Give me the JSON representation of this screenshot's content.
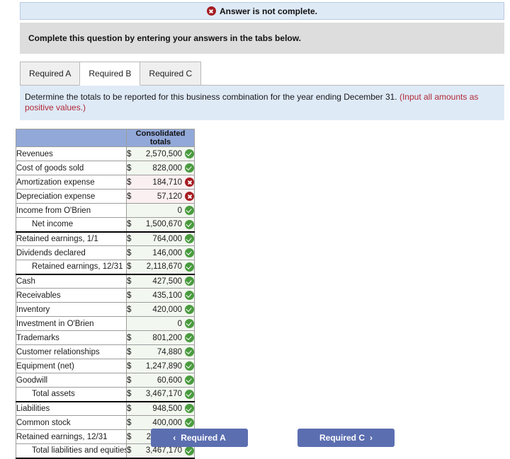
{
  "alert": {
    "icon": "error-x-circle-icon",
    "text": "Answer is not complete."
  },
  "instruction": {
    "text": "Complete this question by entering your answers in the tabs below."
  },
  "tabs": [
    {
      "label": "Required A",
      "active": false
    },
    {
      "label": "Required B",
      "active": true
    },
    {
      "label": "Required C",
      "active": false
    }
  ],
  "prompt": {
    "main": "Determine the totals to be reported for this business combination for the year ending December 31. ",
    "hint": "(Input all amounts as positive values.)"
  },
  "table": {
    "header_blank": "",
    "header_amount": "Consolidated totals",
    "rows": [
      {
        "label": "Revenues",
        "indent": false,
        "currency": "$",
        "amount": "2,570,500",
        "status": "correct",
        "rule": "none"
      },
      {
        "label": "Cost of goods sold",
        "indent": false,
        "currency": "$",
        "amount": "828,000",
        "status": "correct",
        "rule": "none"
      },
      {
        "label": "Amortization expense",
        "indent": false,
        "currency": "$",
        "amount": "184,710",
        "status": "incorrect",
        "rule": "none"
      },
      {
        "label": "Depreciation expense",
        "indent": false,
        "currency": "$",
        "amount": "57,120",
        "status": "incorrect",
        "rule": "none"
      },
      {
        "label": "Income from O'Brien",
        "indent": false,
        "currency": "",
        "amount": "0",
        "status": "correct",
        "rule": "none"
      },
      {
        "label": "Net income",
        "indent": true,
        "currency": "$",
        "amount": "1,500,670",
        "status": "correct",
        "rule": "below"
      },
      {
        "label": "Retained earnings, 1/1",
        "indent": false,
        "currency": "$",
        "amount": "764,000",
        "status": "correct",
        "rule": "none"
      },
      {
        "label": "Dividends declared",
        "indent": false,
        "currency": "$",
        "amount": "146,000",
        "status": "correct",
        "rule": "none"
      },
      {
        "label": "Retained earnings, 12/31",
        "indent": true,
        "currency": "$",
        "amount": "2,118,670",
        "status": "correct",
        "rule": "below"
      },
      {
        "label": "Cash",
        "indent": false,
        "currency": "$",
        "amount": "427,500",
        "status": "correct",
        "rule": "none"
      },
      {
        "label": "Receivables",
        "indent": false,
        "currency": "$",
        "amount": "435,100",
        "status": "correct",
        "rule": "none"
      },
      {
        "label": "Inventory",
        "indent": false,
        "currency": "$",
        "amount": "420,000",
        "status": "correct",
        "rule": "none"
      },
      {
        "label": "Investment in O'Brien",
        "indent": false,
        "currency": "",
        "amount": "0",
        "status": "correct",
        "rule": "none"
      },
      {
        "label": "Trademarks",
        "indent": false,
        "currency": "$",
        "amount": "801,200",
        "status": "correct",
        "rule": "none"
      },
      {
        "label": "Customer relationships",
        "indent": false,
        "currency": "$",
        "amount": "74,880",
        "status": "correct",
        "rule": "none"
      },
      {
        "label": "Equipment (net)",
        "indent": false,
        "currency": "$",
        "amount": "1,247,890",
        "status": "correct",
        "rule": "none"
      },
      {
        "label": "Goodwill",
        "indent": false,
        "currency": "$",
        "amount": "60,600",
        "status": "correct",
        "rule": "none"
      },
      {
        "label": "Total assets",
        "indent": true,
        "currency": "$",
        "amount": "3,467,170",
        "status": "correct",
        "rule": "below"
      },
      {
        "label": "Liabilities",
        "indent": false,
        "currency": "$",
        "amount": "948,500",
        "status": "correct",
        "rule": "none"
      },
      {
        "label": "Common stock",
        "indent": false,
        "currency": "$",
        "amount": "400,000",
        "status": "correct",
        "rule": "none"
      },
      {
        "label": "Retained earnings, 12/31",
        "indent": false,
        "currency": "$",
        "amount": "2,118,670",
        "status": "correct",
        "rule": "none"
      },
      {
        "label": "Total liabilities and equities",
        "indent": true,
        "currency": "$",
        "amount": "3,467,170",
        "status": "correct",
        "rule": "below"
      }
    ]
  },
  "footer": {
    "prev": {
      "label": "Required A",
      "chevron": "‹"
    },
    "next": {
      "label": "Required C",
      "chevron": "›"
    }
  }
}
